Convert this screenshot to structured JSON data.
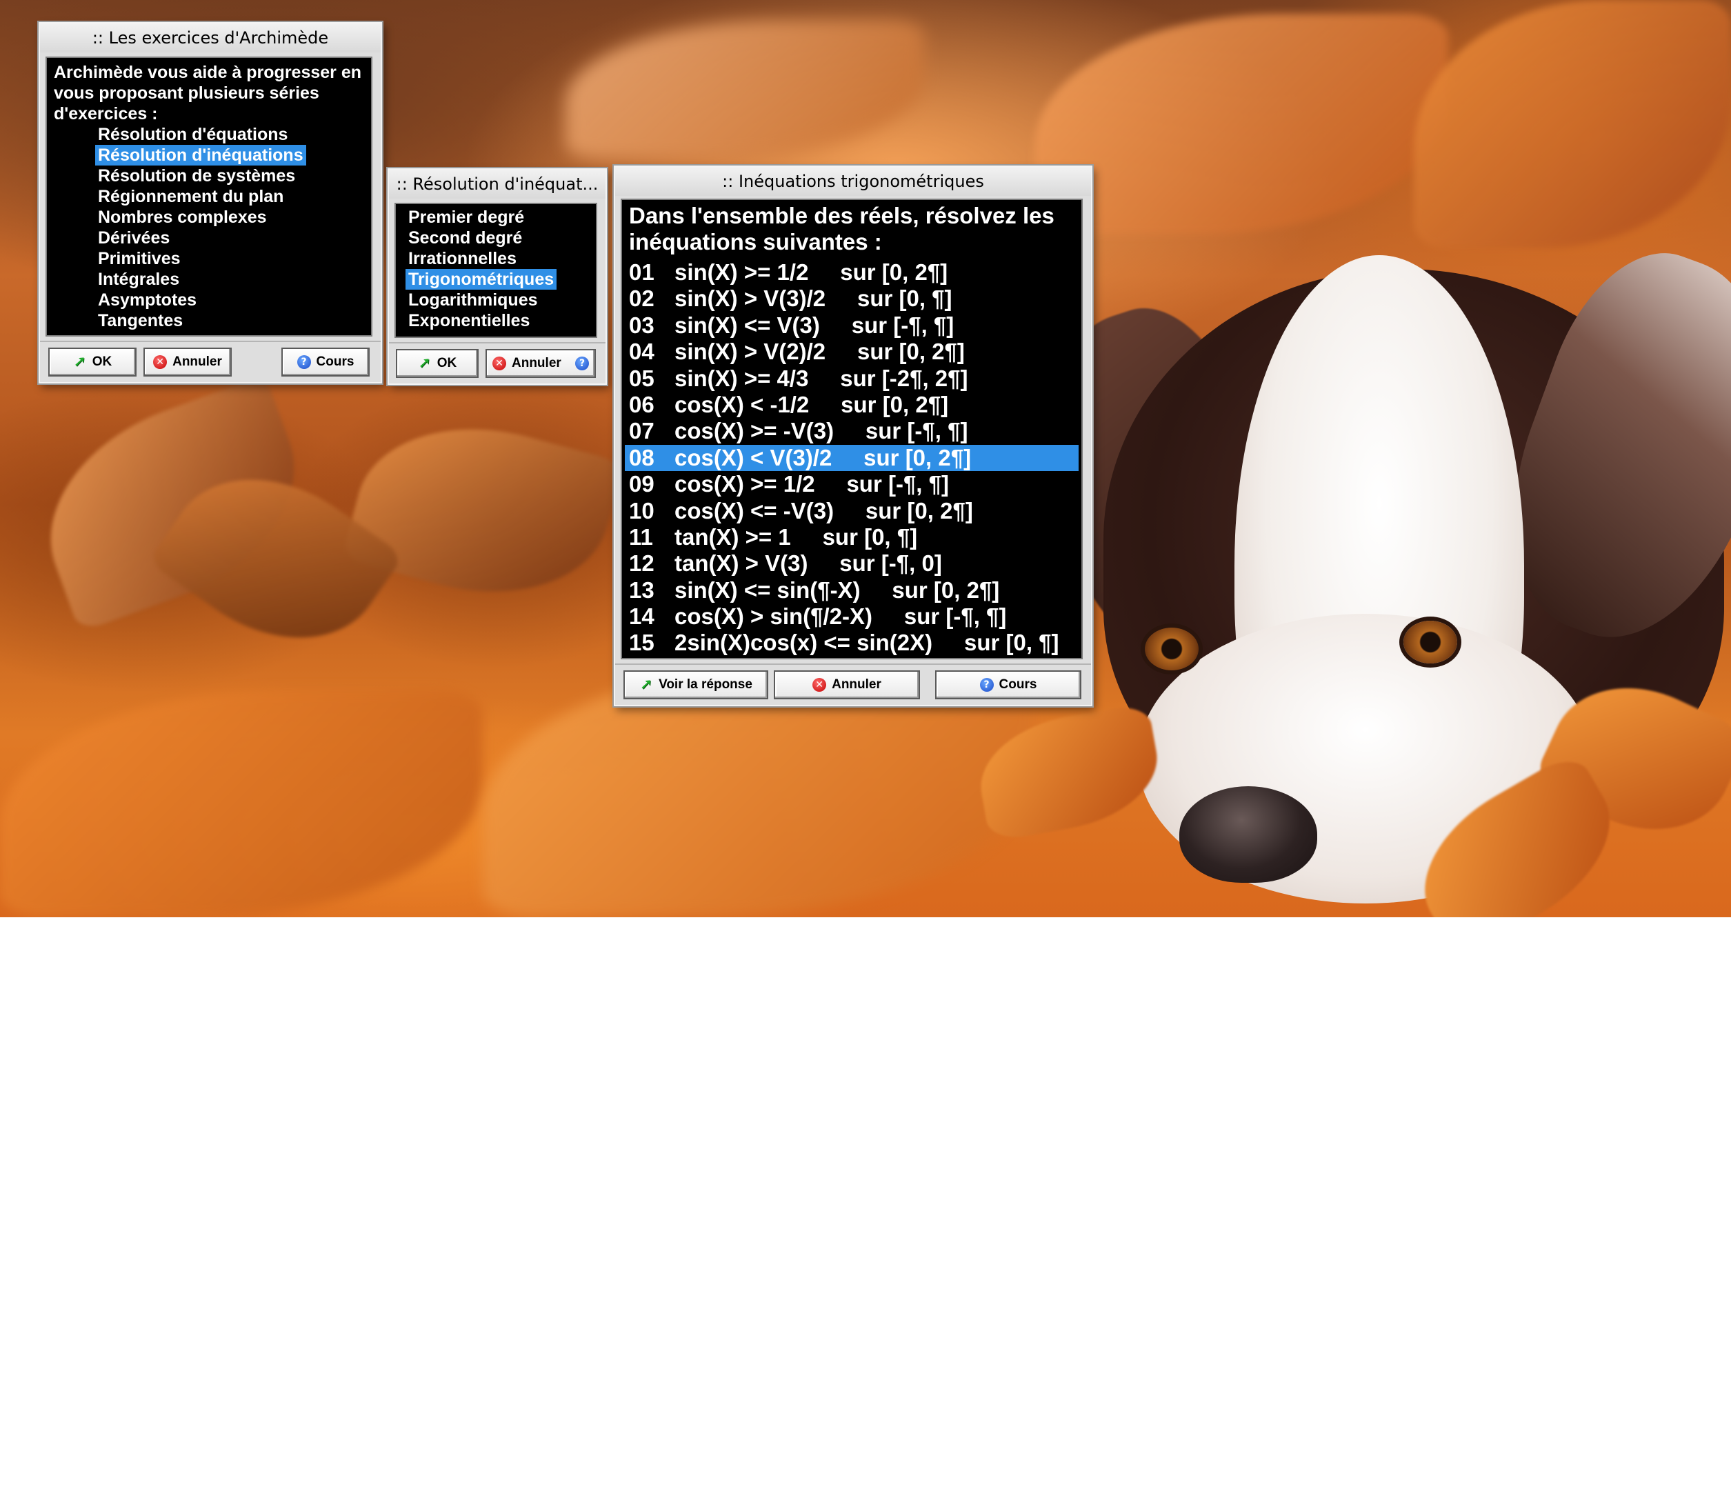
{
  "colors": {
    "selection": "#2f8fe6",
    "panel_bg": "#000000",
    "panel_text": "#ffffff",
    "window_chrome": "#dedede"
  },
  "icons": {
    "ok": "green-arrow-icon",
    "cancel": "red-x-icon",
    "help": "blue-question-icon"
  },
  "window_archimede": {
    "title": ":: Les exercices d'Archimède",
    "intro": "Archimède vous aide à progresser en vous proposant plusieurs séries d'exercices :",
    "items": [
      {
        "label": "Résolution d'équations",
        "selected": false
      },
      {
        "label": "Résolution d'inéquations",
        "selected": true
      },
      {
        "label": "Résolution de systèmes",
        "selected": false
      },
      {
        "label": "Régionnement du plan",
        "selected": false
      },
      {
        "label": "Nombres complexes",
        "selected": false
      },
      {
        "label": "Dérivées",
        "selected": false
      },
      {
        "label": "Primitives",
        "selected": false
      },
      {
        "label": "Intégrales",
        "selected": false
      },
      {
        "label": "Asymptotes",
        "selected": false
      },
      {
        "label": "Tangentes",
        "selected": false
      }
    ],
    "ok_label": "OK",
    "cancel_label": "Annuler",
    "course_label": "Cours"
  },
  "window_inequations": {
    "title": ":: Résolution d'inéquat...",
    "items": [
      {
        "label": "Premier degré",
        "selected": false
      },
      {
        "label": "Second degré",
        "selected": false
      },
      {
        "label": "Irrationnelles",
        "selected": false
      },
      {
        "label": "Trigonométriques",
        "selected": true
      },
      {
        "label": "Logarithmiques",
        "selected": false
      },
      {
        "label": "Exponentielles",
        "selected": false
      }
    ],
    "ok_label": "OK",
    "cancel_label": "Annuler"
  },
  "window_trig": {
    "title": ":: Inéquations trigonométriques",
    "intro": "Dans l'ensemble des réels, résolvez les inéquations suivantes :",
    "exercises": [
      {
        "num": "01",
        "text": "sin(X) >= 1/2     sur [0, 2¶]",
        "selected": false
      },
      {
        "num": "02",
        "text": "sin(X) > V(3)/2     sur [0, ¶]",
        "selected": false
      },
      {
        "num": "03",
        "text": "sin(X) <= V(3)     sur [-¶, ¶]",
        "selected": false
      },
      {
        "num": "04",
        "text": "sin(X) > V(2)/2     sur [0, 2¶]",
        "selected": false
      },
      {
        "num": "05",
        "text": "sin(X) >= 4/3     sur [-2¶, 2¶]",
        "selected": false
      },
      {
        "num": "06",
        "text": "cos(X) < -1/2     sur [0, 2¶]",
        "selected": false
      },
      {
        "num": "07",
        "text": "cos(X) >= -V(3)     sur [-¶, ¶]",
        "selected": false
      },
      {
        "num": "08",
        "text": "cos(X) < V(3)/2     sur [0, 2¶]",
        "selected": true
      },
      {
        "num": "09",
        "text": "cos(X) >= 1/2     sur [-¶, ¶]",
        "selected": false
      },
      {
        "num": "10",
        "text": "cos(X) <= -V(3)     sur [0, 2¶]",
        "selected": false
      },
      {
        "num": "11",
        "text": "tan(X) >= 1     sur [0, ¶]",
        "selected": false
      },
      {
        "num": "12",
        "text": "tan(X) > V(3)     sur [-¶, 0]",
        "selected": false
      },
      {
        "num": "13",
        "text": "sin(X) <= sin(¶-X)     sur [0, 2¶]",
        "selected": false
      },
      {
        "num": "14",
        "text": "cos(X) > sin(¶/2-X)     sur [-¶, ¶]",
        "selected": false
      },
      {
        "num": "15",
        "text": "2sin(X)cos(x) <= sin(2X)     sur [0, ¶]",
        "selected": false
      }
    ],
    "answer_label": "Voir la réponse",
    "cancel_label": "Annuler",
    "course_label": "Cours"
  }
}
